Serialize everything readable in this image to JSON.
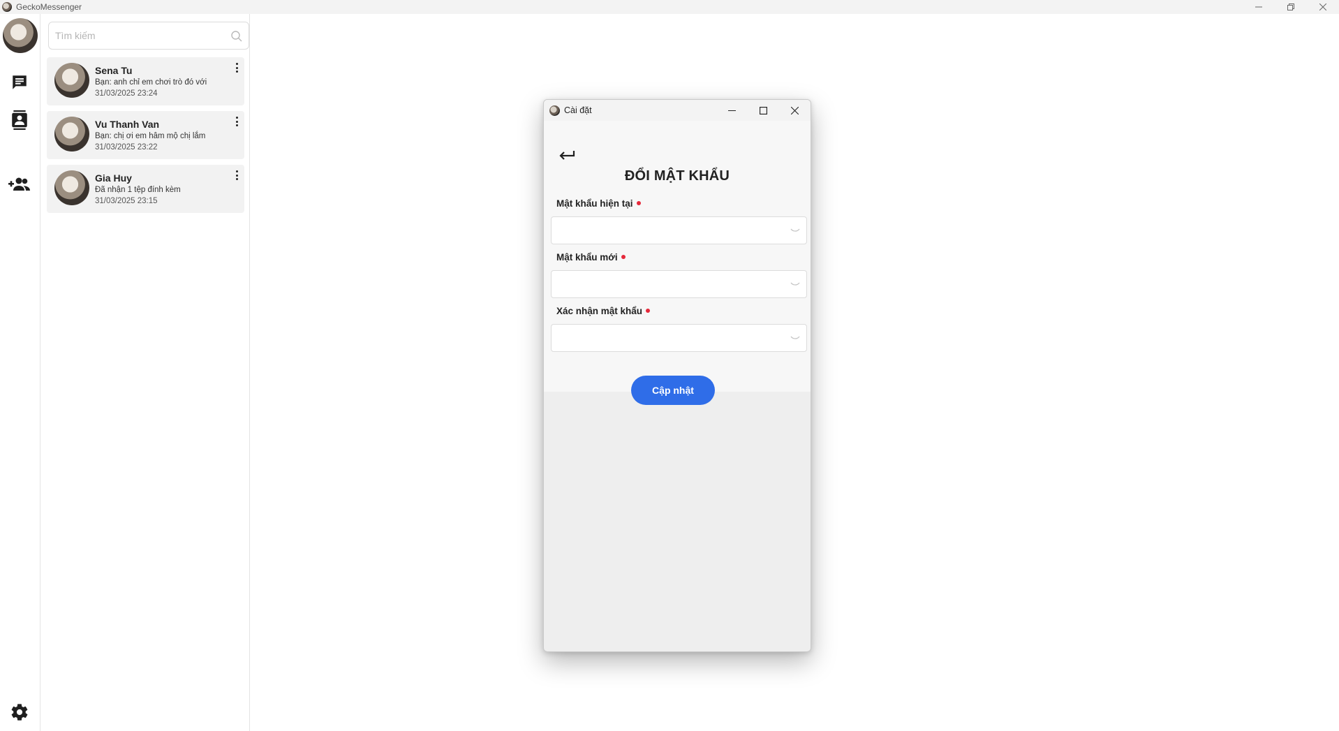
{
  "window": {
    "title": "GeckoMessenger",
    "controls": [
      "minimize-icon",
      "restore-icon",
      "close-icon"
    ]
  },
  "rail": {
    "icons": [
      "avatar",
      "chat-icon",
      "contacts-icon",
      "add-friend-icon",
      "gear-icon"
    ]
  },
  "search": {
    "placeholder": "Tìm kiếm",
    "value": ""
  },
  "conversations": [
    {
      "name": "Sena Tu",
      "preview": "Bạn: anh chỉ em chơi trò đó với",
      "time": "31/03/2025 23:24"
    },
    {
      "name": "Vu Thanh Van",
      "preview": "Bạn: chị ơi em hâm mộ chị lắm",
      "time": "31/03/2025 23:22"
    },
    {
      "name": "Gia Huy",
      "preview": "Đã nhận 1 tệp đính kèm",
      "time": "31/03/2025 23:15"
    }
  ],
  "dialog": {
    "title": "Cài đặt",
    "heading": "ĐỔI MẬT KHẨU",
    "fields": [
      {
        "label": "Mật khẩu hiện tại",
        "value": ""
      },
      {
        "label": "Mật khẩu mới",
        "value": ""
      },
      {
        "label": "Xác nhận mật khẩu",
        "value": ""
      }
    ],
    "submit_label": "Cập nhật"
  },
  "colors": {
    "accent": "#2f6de8",
    "required": "#e5283a",
    "conversation_bg": "#f2f2f2"
  }
}
